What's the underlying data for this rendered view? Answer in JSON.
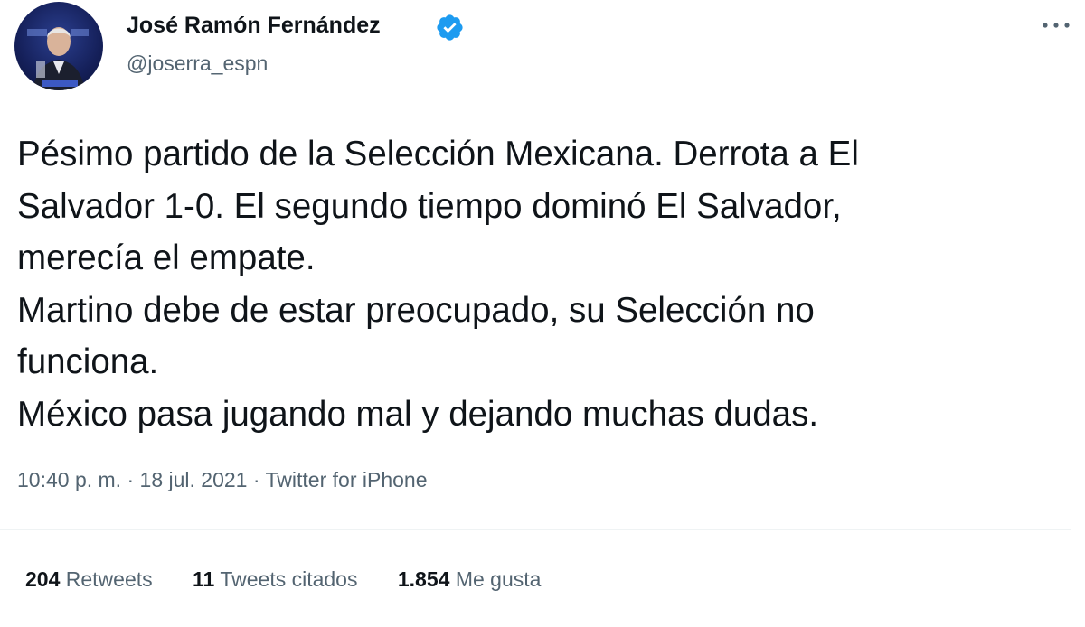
{
  "author": {
    "name": "José Ramón Fernández",
    "handle": "@joserra_espn",
    "verified": true,
    "verified_icon": "verified-badge-icon"
  },
  "tweet": {
    "text_lines": [
      "Pésimo partido de la Selección Mexicana. Derrota a El",
      "Salvador 1-0. El segundo tiempo dominó El Salvador,",
      "merecía el empate.",
      "Martino debe de estar preocupado, su Selección no",
      "funciona.",
      "México pasa jugando mal y dejando muchas dudas."
    ],
    "time": "10:40 p. m.",
    "separator": "·",
    "date": "18 jul. 2021",
    "source": "Twitter for iPhone"
  },
  "stats": {
    "retweets_count": "204",
    "retweets_label": "Retweets",
    "quotes_count": "11",
    "quotes_label": "Tweets citados",
    "likes_count": "1.854",
    "likes_label": "Me gusta"
  },
  "colors": {
    "text": "#0f1419",
    "secondary": "#536471",
    "verified": "#1d9bf0",
    "divider": "#eff3f4"
  }
}
